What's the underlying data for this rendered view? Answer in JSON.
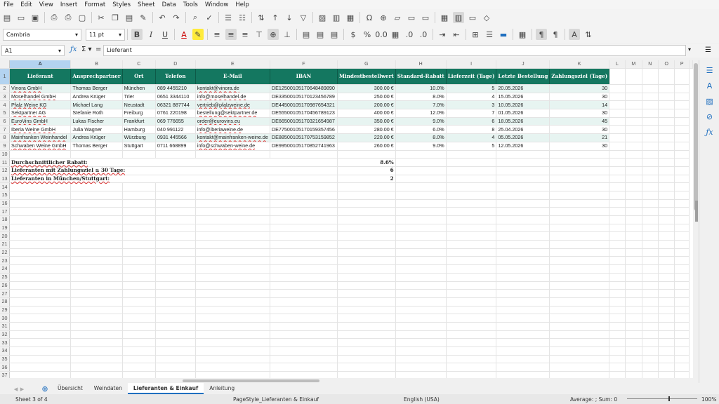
{
  "menu": [
    "File",
    "Edit",
    "View",
    "Insert",
    "Format",
    "Styles",
    "Sheet",
    "Data",
    "Tools",
    "Window",
    "Help"
  ],
  "format_bar": {
    "font_name": "Cambria",
    "font_size": "11 pt"
  },
  "formula_bar": {
    "cell_ref": "A1",
    "content": "Lieferant"
  },
  "columns": [
    "A",
    "B",
    "C",
    "D",
    "E",
    "F",
    "G",
    "H",
    "I",
    "J",
    "K",
    "L",
    "M",
    "N",
    "O",
    "P"
  ],
  "header_row": [
    "Lieferant",
    "Ansprechpartner",
    "Ort",
    "Telefon",
    "E-Mail",
    "IBAN",
    "Mindestbestellwert",
    "Standard-Rabatt",
    "Lieferzeit (Tage)",
    "Letzte Bestellung",
    "Zahlungsziel (Tage)"
  ],
  "rows": [
    [
      "Vinora GmbH",
      "Thomas Berger",
      "München",
      "089 4455210",
      "kontakt@vinora.de",
      "DE12500105170648489890",
      "300.00 €",
      "10.0%",
      "5",
      "20.05.2026",
      "30"
    ],
    [
      "Moselhandel GmbH",
      "Andrea Krüger",
      "Trier",
      "0651 3344110",
      "info@moselhandel.de",
      "DE33500105170123456789",
      "250.00 €",
      "8.0%",
      "4",
      "15.05.2026",
      "30"
    ],
    [
      "Pfalz Weine KG",
      "Michael Lang",
      "Neustadt",
      "06321 887744",
      "vertrieb@pfalzweine.de",
      "DE44500105170987654321",
      "200.00 €",
      "7.0%",
      "3",
      "10.05.2026",
      "14"
    ],
    [
      "Sektpartner AG",
      "Stefanie Roth",
      "Freiburg",
      "0761 220198",
      "bestellung@sektpartner.de",
      "DE55500105170456789123",
      "400.00 €",
      "12.0%",
      "7",
      "01.05.2026",
      "30"
    ],
    [
      "EuroVins GmbH",
      "Lukas Fischer",
      "Frankfurt",
      "069 776655",
      "order@eurovins.eu",
      "DE66500105170321654987",
      "350.00 €",
      "9.0%",
      "6",
      "18.05.2026",
      "45"
    ],
    [
      "Iberia Weine GmbH",
      "Julia Wagner",
      "Hamburg",
      "040 991122",
      "info@iberiaweine.de",
      "DE77500105170159357456",
      "280.00 €",
      "6.0%",
      "8",
      "25.04.2026",
      "30"
    ],
    [
      "Mainfranken Weinhandel",
      "Andrea Krüger",
      "Würzburg",
      "0931 445566",
      "kontakt@mainfranken-weine.de",
      "DE88500105170753159852",
      "220.00 €",
      "8.0%",
      "4",
      "05.05.2026",
      "21"
    ],
    [
      "Schwaben Weine GmbH",
      "Thomas Berger",
      "Stuttgart",
      "0711 668899",
      "info@schwaben-weine.de",
      "DE99500105170852741963",
      "260.00 €",
      "9.0%",
      "5",
      "12.05.2026",
      "30"
    ]
  ],
  "summary": [
    {
      "label": "Durchschnittlicher Rabatt:",
      "value": "8.6%"
    },
    {
      "label": "Lieferanten mit Zahlungsziel ≥ 30 Tage:",
      "value": "6"
    },
    {
      "label": "Lieferanten in München/Stuttgart:",
      "value": "2"
    }
  ],
  "sheet_tabs": [
    "Übersicht",
    "Weindaten",
    "Lieferanten & Einkauf",
    "Anleitung"
  ],
  "active_tab": "Lieferanten & Einkauf",
  "status": {
    "sheet": "Sheet 3 of 4",
    "page_style": "PageStyle_Lieferanten & Einkauf",
    "language": "English (USA)",
    "selection": "Average: ; Sum: 0",
    "zoom": "100%"
  },
  "colors": {
    "header_bg": "#147760",
    "alt_row": "#e7f4f1",
    "accent": "#1f6fbf"
  }
}
